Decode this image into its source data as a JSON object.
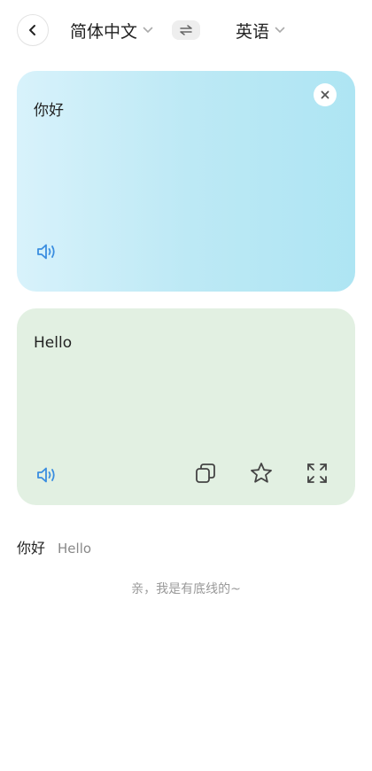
{
  "header": {
    "source_language": "简体中文",
    "target_language": "英语"
  },
  "source_card": {
    "text": "你好",
    "background": "#bde9f5"
  },
  "result_card": {
    "text": "Hello",
    "background": "#e2f0e2"
  },
  "history": {
    "items": [
      {
        "source": "你好",
        "translation": "Hello"
      }
    ]
  },
  "footer_note": "亲，我是有底线的~",
  "colors": {
    "accent": "#3a8de0",
    "icon": "#444444"
  },
  "icons": [
    "back-arrow-icon",
    "chevron-down-icon",
    "swap-icon",
    "close-icon",
    "speaker-icon",
    "copy-icon",
    "star-icon",
    "fullscreen-icon"
  ]
}
